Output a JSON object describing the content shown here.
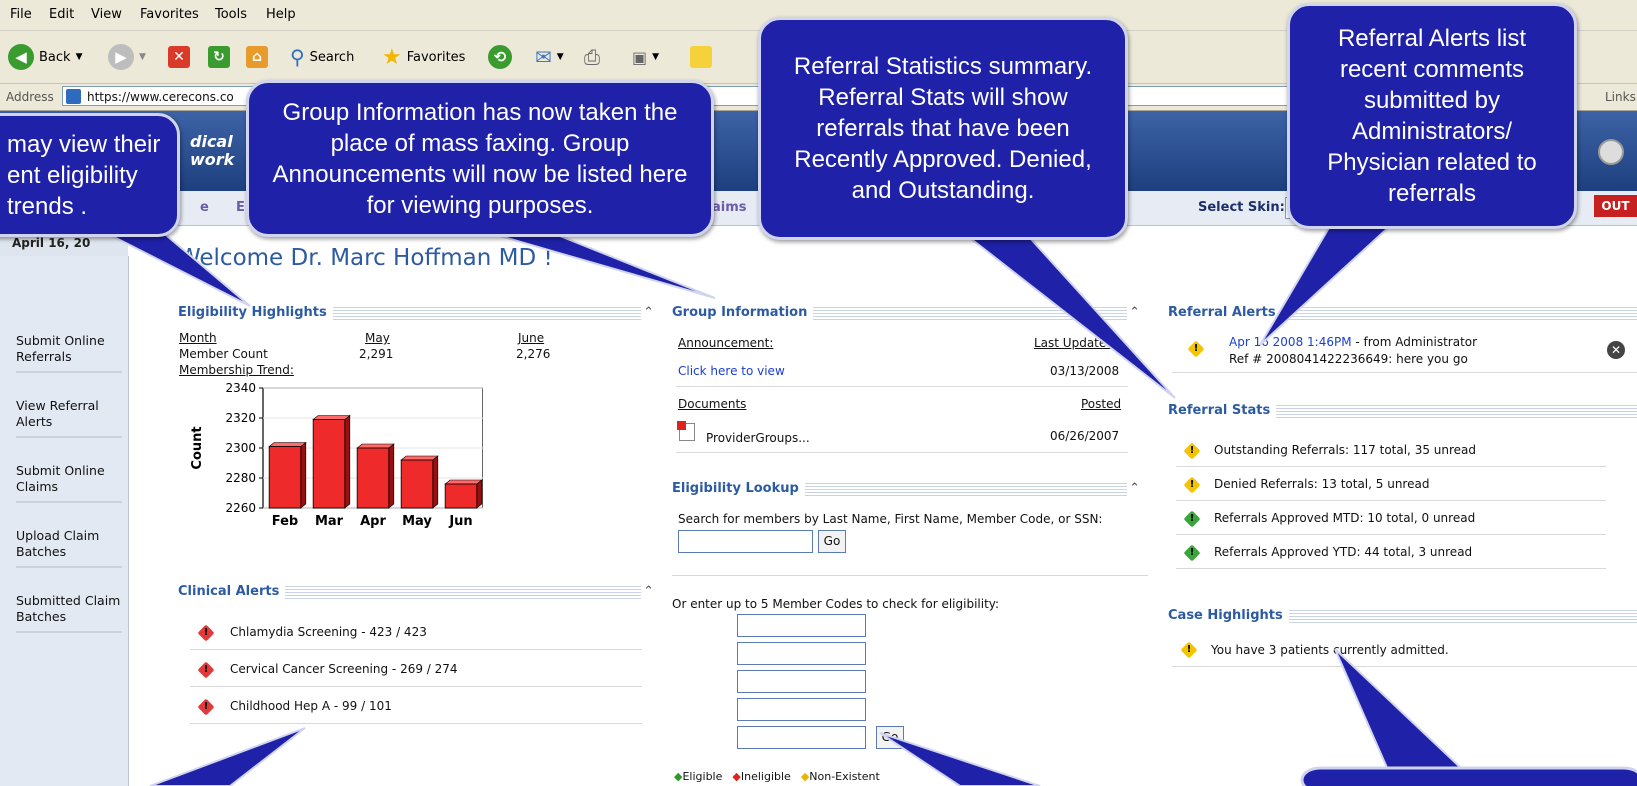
{
  "browser": {
    "menu": [
      "File",
      "Edit",
      "View",
      "Favorites",
      "Tools",
      "Help"
    ],
    "toolbar": {
      "back": "Back",
      "search": "Search",
      "favorites": "Favorites"
    },
    "address_label": "Address",
    "url": "https://www.cerecons.co",
    "links_label": "Links"
  },
  "header": {
    "logo_line1": "dical",
    "logo_line2": "work",
    "nav": [
      "e",
      "E",
      "aims"
    ],
    "select_skin_label": "Select Skin:",
    "logout_label": "OUT"
  },
  "sidebar": {
    "date": "April 16, 20",
    "items": [
      "Submit Online Referrals",
      "View Referral Alerts",
      "Submit Online Claims",
      "Upload Claim Batches",
      "Submitted Claim Batches"
    ]
  },
  "welcome": "Welcome Dr. Marc Hoffman MD !",
  "eligibility": {
    "title": "Eligibility Highlights",
    "collapse": "⌃",
    "month_label": "Month",
    "member_count_label": "Member Count",
    "trend_label": "Membership Trend:",
    "col1": "May",
    "col1_value": "2,291",
    "col2": "June",
    "col2_value": "2,276"
  },
  "chart_data": {
    "type": "bar",
    "categories": [
      "Feb",
      "Mar",
      "Apr",
      "May",
      "Jun"
    ],
    "values": [
      2301,
      2319,
      2300,
      2292,
      2276
    ],
    "ylabel": "Count",
    "ylim": [
      2260,
      2340
    ],
    "yticks": [
      "2340",
      "2320",
      "2300",
      "2280",
      "2260"
    ],
    "bar_color": "#ee2a2a"
  },
  "clinical": {
    "title": "Clinical Alerts",
    "items": [
      "Chlamydia Screening - 423 / 423",
      "Cervical Cancer Screening - 269 / 274",
      "Childhood Hep A - 99 / 101"
    ]
  },
  "group": {
    "title": "Group Information",
    "announcement_label": "Announcement:",
    "last_updated_label": "Last Updated",
    "click_link": "Click here to view",
    "click_date": "03/13/2008",
    "documents_label": "Documents",
    "posted_label": "Posted",
    "doc_name": "ProviderGroups...",
    "doc_date": "06/26/2007"
  },
  "lookup": {
    "title": "Eligibility Lookup",
    "instruction": "Search for members by Last Name, First Name, Member Code, or SSN:",
    "go": "Go",
    "multi_instruction": "Or enter up to 5 Member Codes to check for eligibility:",
    "legend": [
      "Eligible",
      "Ineligible",
      "Non-Existent"
    ]
  },
  "referral_alerts": {
    "title": "Referral Alerts",
    "time": "Apr 16 2008 1:46PM",
    "from": " - from Administrator",
    "ref": "Ref # 2008041422236649: here you go"
  },
  "referral_stats": {
    "title": "Referral Stats",
    "items": [
      "Outstanding Referrals: 117 total, 35 unread",
      "Denied Referrals: 13 total, 5 unread",
      "Referrals Approved MTD: 10 total, 0 unread",
      "Referrals Approved YTD: 44 total, 3 unread"
    ]
  },
  "case": {
    "title": "Case Highlights",
    "text": "You have 3 patients currently admitted."
  },
  "callouts": {
    "c1": "may view their ent eligibility trends .",
    "c2": "Group Information has now taken the place of mass faxing. Group Announcements will now be listed here for viewing purposes.",
    "c3": "Referral Statistics summary. Referral Stats will show  referrals that have been Recently Approved. Denied, and Outstanding.",
    "c4": "Referral Alerts list recent comments submitted by Administrators/ Physician related to referrals"
  }
}
